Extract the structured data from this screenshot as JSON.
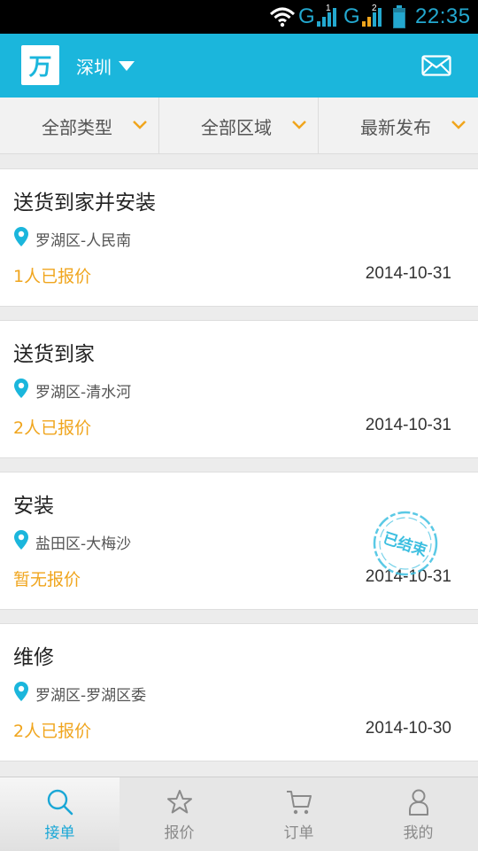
{
  "status_bar": {
    "network_1": "G",
    "sim_1": "1",
    "network_2": "G",
    "sim_2": "2",
    "time": "22:35"
  },
  "header": {
    "logo_char": "万",
    "city": "深圳",
    "icons": {
      "dropdown": "caret-down-icon",
      "messages": "mail-icon"
    }
  },
  "filters": [
    {
      "label": "全部类型"
    },
    {
      "label": "全部区域"
    },
    {
      "label": "最新发布"
    }
  ],
  "listings": [
    {
      "title": "送货到家并安装",
      "location": "罗湖区-人民南",
      "quote_status": "1人已报价",
      "date": "2014-10-31"
    },
    {
      "title": "送货到家",
      "location": "罗湖区-清水河",
      "quote_status": "2人已报价",
      "date": "2014-10-31"
    },
    {
      "title": "安装",
      "location": "盐田区-大梅沙",
      "quote_status": "暂无报价",
      "date": "2014-10-31",
      "stamp": "已结束"
    },
    {
      "title": "维修",
      "location": "罗湖区-罗湖区委",
      "quote_status": "2人已报价",
      "date": "2014-10-30"
    }
  ],
  "bottom_nav": {
    "active_index": 0,
    "tabs": [
      {
        "label": "接单",
        "icon": "search-icon"
      },
      {
        "label": "报价",
        "icon": "star-icon"
      },
      {
        "label": "订单",
        "icon": "cart-icon"
      },
      {
        "label": "我的",
        "icon": "user-icon"
      }
    ]
  },
  "colors": {
    "brand": "#1bb6dc",
    "accent_orange": "#f0a51d",
    "active_tab": "#1aa7d6",
    "inactive_tab": "#8a8a8a"
  }
}
